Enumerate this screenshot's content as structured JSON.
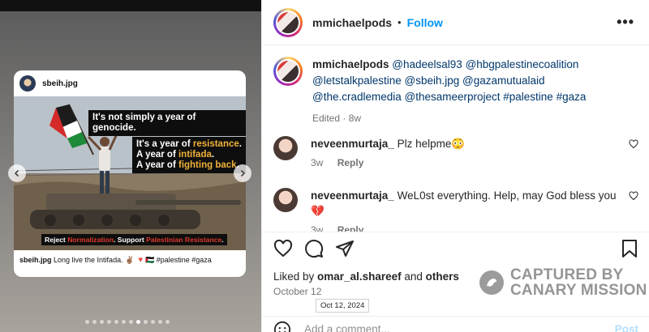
{
  "media": {
    "card_username": "sbeih.jpg",
    "headline_1": "It's not simply a year of genocide.",
    "headline_2_a": "It's a year of ",
    "headline_2_b": "resistance",
    "headline_2_c": ".",
    "headline_3_a": "A year of ",
    "headline_3_b": "intifada",
    "headline_3_c": ".",
    "headline_4_a": "A year of ",
    "headline_4_b": "fighting back",
    "headline_4_c": ".",
    "banner_a": "Reject ",
    "banner_b": "Normalization",
    "banner_c": ". Support ",
    "banner_d": "Palestinian Resistance",
    "banner_e": ".",
    "caption_user": "sbeih.jpg",
    "caption_text": " Long live the Intifada. ✌🏽 🔻🇵🇸 #palestine #gaza",
    "prev_icon": "chevron-left-icon",
    "next_icon": "chevron-right-icon",
    "slide_count": 12,
    "active_slide": 8
  },
  "header": {
    "username": "mmichaelpods",
    "separator": "•",
    "follow_label": "Follow",
    "more_icon": "•••"
  },
  "caption": {
    "username": "mmichaelpods",
    "text_links": "@hadeelsal93 @hbgpalestinecoalition @letstalkpalestine @sbeih.jpg @gazamutualaid @the.cradlemedia @thesameerproject #palestine #gaza",
    "meta": "Edited · 8w"
  },
  "comments": [
    {
      "username": "neveenmurtaja_",
      "text": "Plz helpme😳",
      "age": "3w",
      "reply": "Reply"
    },
    {
      "username": "neveenmurtaja_",
      "text": "WeL0st everything. Help, may God bless you 💔",
      "age": "3w",
      "reply": "Reply"
    }
  ],
  "footer": {
    "liked_by_prefix": "Liked by ",
    "liked_by_user": "omar_al.shareef",
    "liked_by_mid": " and ",
    "liked_by_others": "others",
    "date": "October 12",
    "tooltip": "Oct 12, 2024",
    "add_comment_placeholder": "Add a comment...",
    "post_label": "Post"
  },
  "watermark": {
    "line1": "CAPTURED BY",
    "line2": "CANARY MISSION"
  },
  "colors": {
    "accent": "#0095f6",
    "link": "#00376b",
    "highlight": "#f0b23a",
    "banner_red": "#e0392b"
  }
}
